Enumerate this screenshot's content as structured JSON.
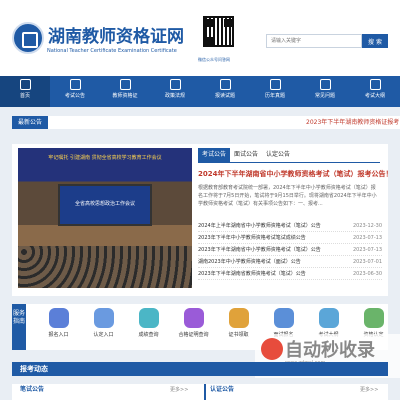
{
  "header": {
    "title": "湖南教师资格证网",
    "subtitle": "National Teacher Certificate Examination Certificate",
    "qr_caption": "微信公众号问答网"
  },
  "search": {
    "placeholder": "请输入关键字",
    "button": "搜 索"
  },
  "nav": [
    "首页",
    "考试公告",
    "教师资格证",
    "政策法规",
    "报读试题",
    "历年真题",
    "常见问题",
    "考试大纲"
  ],
  "news": {
    "label": "最新公告",
    "text": "2023年下半年湖南教师资格证报考"
  },
  "photo": {
    "banner": "牢记嘱托 引建湖南 贯彻全省高校学习教育工作会议",
    "screen_text": "全省高校思想政治工作会议"
  },
  "tabs": [
    "考试公告",
    "面试公告",
    "认定公告"
  ],
  "headline": {
    "title": "2024年下半年湖南省中小学教师资格考试（笔试）报考公告！",
    "summary": "根据教育部教育考试院统一部署，2024年下半年中小学教师资格考试（笔试）报名工作将于7月5日开始，笔试将于9月15日举行。现将湖南省2024年下半年中小学教师资格考试（笔试）有关事项公告如下：一、报考..."
  },
  "list": [
    {
      "title": "2024年上半年湖南省中小学教师资格考试（笔试）公告",
      "date": "2023-12-30"
    },
    {
      "title": "2023年下半年中小学教师资格考试笔试成绩公告",
      "date": "2023-07-13"
    },
    {
      "title": "2023年下半年湖南省中小学教师资格考试（笔试）公告",
      "date": "2023-07-13"
    },
    {
      "title": "湖南2023年中小学教师资格考试（面试）公告",
      "date": "2023-07-01"
    },
    {
      "title": "2023年下半年湖南省教师资格考试（笔试）公告",
      "date": "2023-06-30"
    }
  ],
  "service": {
    "label": "服务指南",
    "items": [
      {
        "name": "报名入口",
        "color": "#5b7fd8"
      },
      {
        "name": "认定入口",
        "color": "#6a9ae0"
      },
      {
        "name": "成绩查询",
        "color": "#4bb6c6"
      },
      {
        "name": "合格证明查询",
        "color": "#9a5bd8"
      },
      {
        "name": "证书领取",
        "color": "#e0a23a"
      },
      {
        "name": "面试报名",
        "color": "#5b8fd8"
      },
      {
        "name": "考试大纲",
        "color": "#5ba6d8"
      },
      {
        "name": "资格认定",
        "color": "#6ab46a"
      }
    ]
  },
  "watermark": {
    "text": "自动秒收录",
    "sub": "www.zdmsl.com"
  },
  "dynamic": {
    "title": "报考动态"
  },
  "bottom": {
    "col1": "笔试公告",
    "more1": "更多>>",
    "col2": "认证公告",
    "more2": "更多>>"
  }
}
